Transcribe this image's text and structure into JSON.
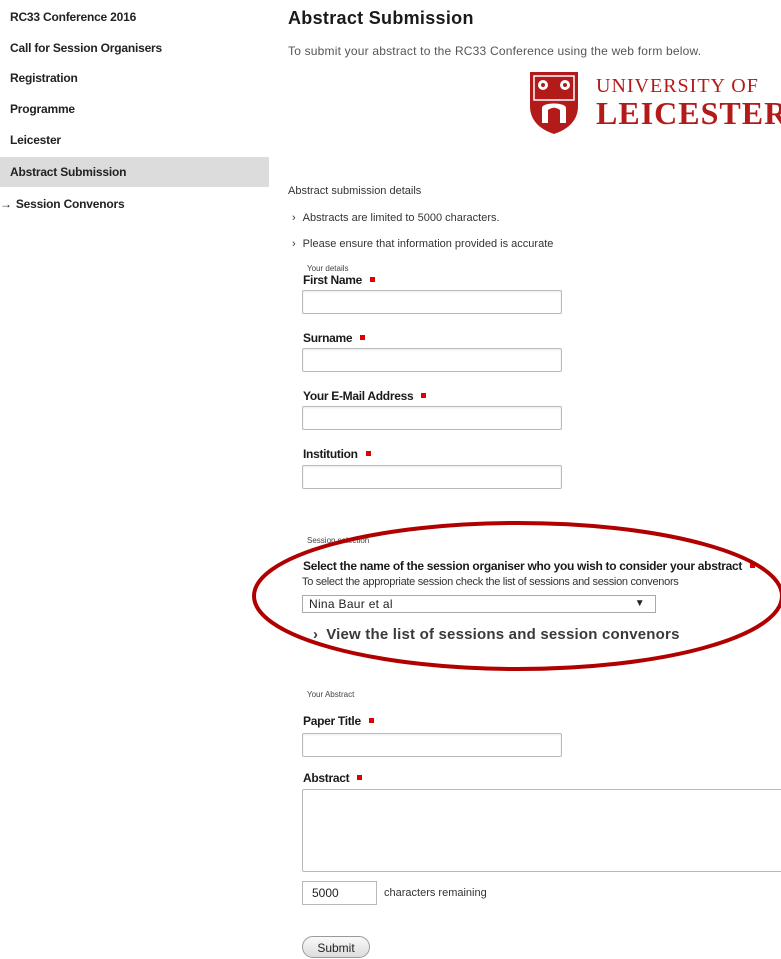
{
  "sidebar": {
    "items": [
      {
        "label": "RC33 Conference 2016"
      },
      {
        "label": "Call for Session Organisers"
      },
      {
        "label": "Registration"
      },
      {
        "label": "Programme"
      },
      {
        "label": "Leicester"
      },
      {
        "label": "Abstract Submission"
      },
      {
        "label": "Session Convenors",
        "prefix": "→"
      }
    ]
  },
  "header": {
    "title": "Abstract Submission",
    "intro": "To submit your abstract to the RC33 Conference using the web form below."
  },
  "logo": {
    "line1": "UNIVERSITY OF",
    "line2": "LEICESTER",
    "color": "#b31b1b"
  },
  "details": {
    "heading": "Abstract submission details",
    "bullets": [
      "Abstracts are limited to 5000 characters.",
      "Please ensure that information provided is accurate"
    ]
  },
  "your_details": {
    "legend": "Your details",
    "fields": [
      {
        "label": "First Name",
        "value": ""
      },
      {
        "label": "Surname",
        "value": ""
      },
      {
        "label": "Your E-Mail Address",
        "value": ""
      },
      {
        "label": "Institution",
        "value": ""
      }
    ]
  },
  "session": {
    "legend": "Session selection",
    "label": "Select the name of the session organiser who you wish to consider your abstract",
    "help": "To select the appropriate session check the list of sessions and session convenors",
    "selected": "Nina Baur et al",
    "link": "View the list of sessions and session convenors"
  },
  "abstract": {
    "legend": "Your Abstract",
    "title_label": "Paper Title",
    "title_value": "",
    "abstract_label": "Abstract",
    "abstract_value": "",
    "counter_value": "5000",
    "counter_label": "characters remaining",
    "submit_label": "Submit"
  },
  "colors": {
    "required": "#e00000",
    "annotation": "#b00000",
    "active_nav": "#dcdcdc"
  }
}
